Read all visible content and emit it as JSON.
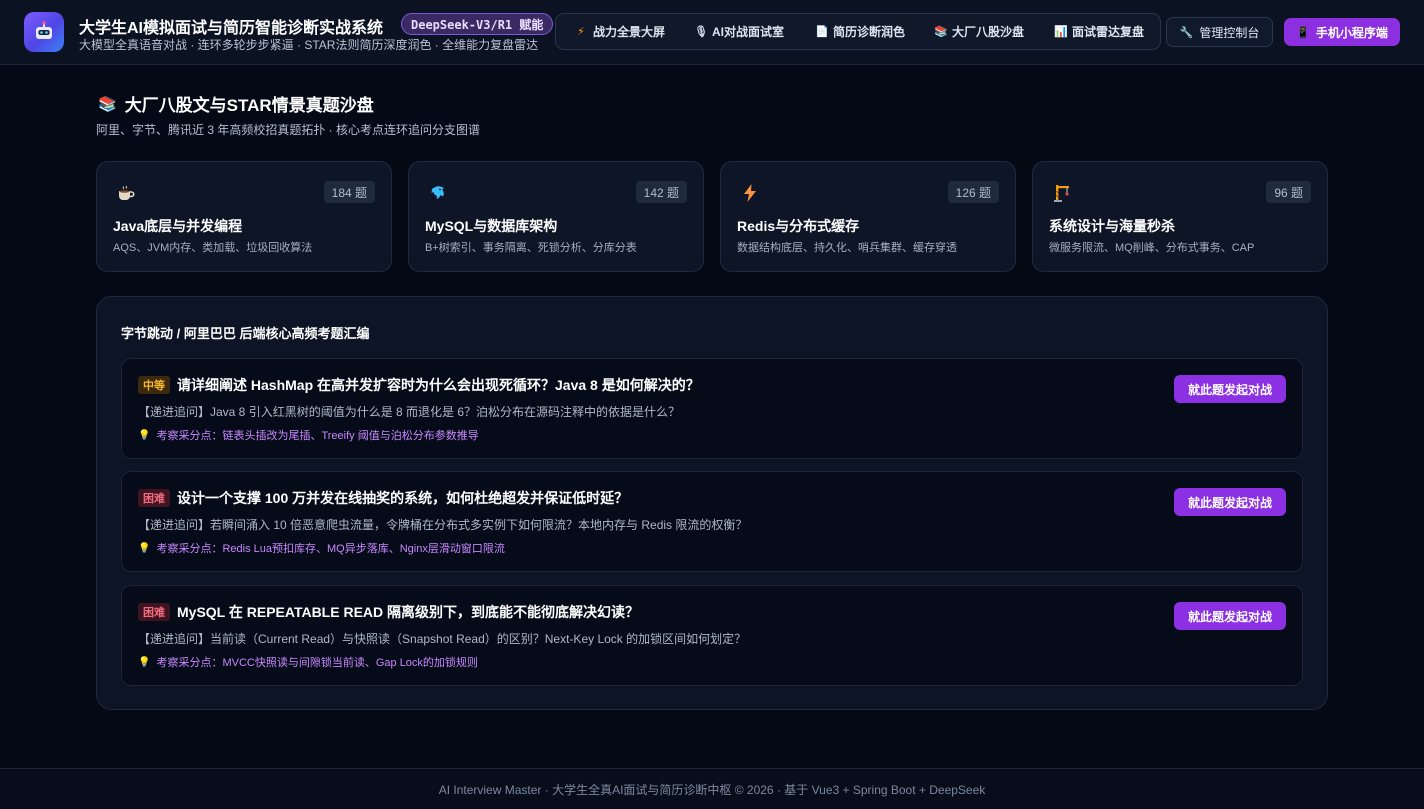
{
  "header": {
    "title": "大学生AI模拟面试与简历智能诊断实战系统",
    "badge": "DeepSeek-V3/R1 赋能",
    "subtitle": "大模型全真语音对战 · 连环多轮步步紧逼 · STAR法则简历深度润色 · 全维能力复盘雷达",
    "logo_icon": "robot-icon",
    "nav": [
      {
        "label": "战力全景大屏",
        "icon": "lightning-icon"
      },
      {
        "label": "AI对战面试室",
        "icon": "microphone-icon"
      },
      {
        "label": "简历诊断润色",
        "icon": "document-icon"
      },
      {
        "label": "大厂八股沙盘",
        "icon": "books-icon"
      },
      {
        "label": "面试雷达复盘",
        "icon": "bar-chart-icon"
      }
    ],
    "admin_label": "管理控制台",
    "admin_icon": "wrench-icon",
    "mini_label": "手机小程序端",
    "mini_icon": "phone-icon"
  },
  "page": {
    "title": "大厂八股文与STAR情景真题沙盘",
    "title_icon": "books-icon",
    "subtitle": "阿里、字节、腾讯近 3 年高频校招真题拓扑 · 核心考点连环追问分支图谱"
  },
  "categories": [
    {
      "name": "Java底层与并发编程",
      "count": "184 题",
      "desc": "AQS、JVM内存、类加载、垃圾回收算法",
      "icon": "coffee-icon"
    },
    {
      "name": "MySQL与数据库架构",
      "count": "142 题",
      "desc": "B+树索引、事务隔离、死锁分析、分库分表",
      "icon": "dolphin-icon"
    },
    {
      "name": "Redis与分布式缓存",
      "count": "126 题",
      "desc": "数据结构底层、持久化、哨兵集群、缓存穿透",
      "icon": "lightning-icon"
    },
    {
      "name": "系统设计与海量秒杀",
      "count": "96 题",
      "desc": "微服务限流、MQ削峰、分布式事务、CAP",
      "icon": "crane-icon"
    }
  ],
  "questions_panel": {
    "title": "字节跳动 / 阿里巴巴 后端核心高频考题汇编",
    "action_label": "就此题发起对战",
    "points_prefix": "考察采分点：",
    "questions": [
      {
        "difficulty": "中等",
        "level": "mid",
        "title": "请详细阐述 HashMap 在高并发扩容时为什么会出现死循环？Java 8 是如何解决的？",
        "follow_up": "【递进追问】Java 8 引入红黑树的阈值为什么是 8 而退化是 6？泊松分布在源码注释中的依据是什么？",
        "points": "链表头插改为尾插、Treeify 阈值与泊松分布参数推导"
      },
      {
        "difficulty": "困难",
        "level": "hard",
        "title": "设计一个支撑 100 万并发在线抽奖的系统，如何杜绝超发并保证低时延？",
        "follow_up": "【递进追问】若瞬间涌入 10 倍恶意爬虫流量，令牌桶在分布式多实例下如何限流？本地内存与 Redis 限流的权衡？",
        "points": "Redis Lua预扣库存、MQ异步落库、Nginx层滑动窗口限流"
      },
      {
        "difficulty": "困难",
        "level": "hard",
        "title": "MySQL 在 REPEATABLE READ 隔离级别下，到底能不能彻底解决幻读？",
        "follow_up": "【递进追问】当前读（Current Read）与快照读（Snapshot Read）的区别？Next-Key Lock 的加锁区间如何划定？",
        "points": "MVCC快照读与间隙锁当前读、Gap Lock的加锁规则"
      }
    ]
  },
  "footer": {
    "text": "AI Interview Master · 大学生全真AI面试与简历诊断中枢 © 2026 · 基于 Vue3 + Spring Boot + DeepSeek"
  },
  "colors": {
    "background": "#040916",
    "accent_purple": "#8b30e2",
    "medium_badge": "#f7b733",
    "hard_badge": "#f06c7e",
    "points_text": "#c987ff"
  }
}
